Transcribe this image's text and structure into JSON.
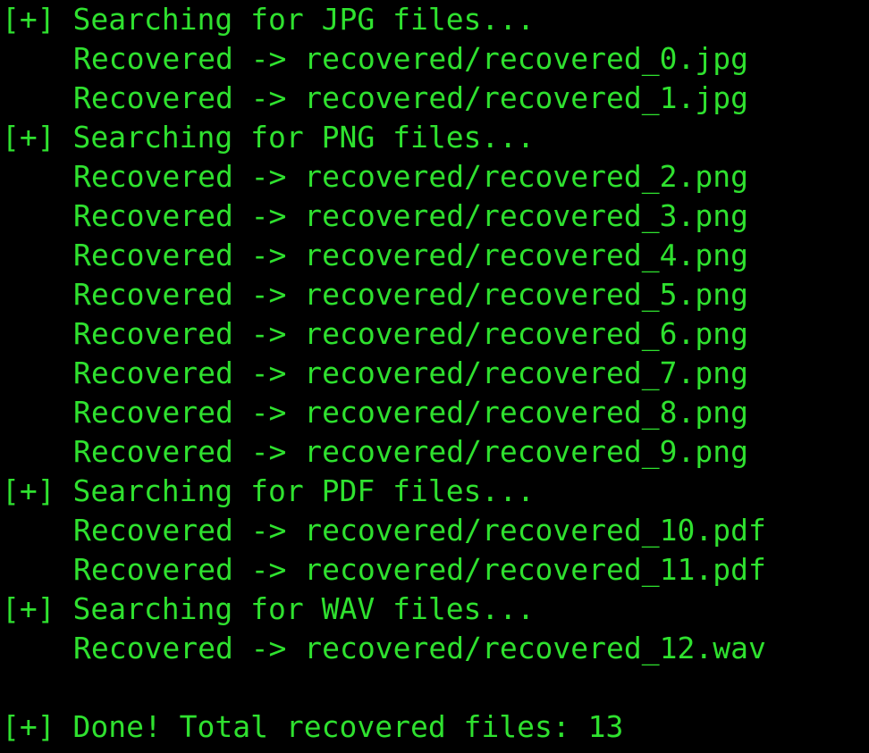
{
  "terminal": {
    "text_color": "#2fe12f",
    "background": "#000000",
    "lines": [
      {
        "text": "[+] Searching for JPG files...",
        "indent": false
      },
      {
        "text": "Recovered -> recovered/recovered_0.jpg",
        "indent": true
      },
      {
        "text": "Recovered -> recovered/recovered_1.jpg",
        "indent": true
      },
      {
        "text": "[+] Searching for PNG files...",
        "indent": false
      },
      {
        "text": "Recovered -> recovered/recovered_2.png",
        "indent": true
      },
      {
        "text": "Recovered -> recovered/recovered_3.png",
        "indent": true
      },
      {
        "text": "Recovered -> recovered/recovered_4.png",
        "indent": true
      },
      {
        "text": "Recovered -> recovered/recovered_5.png",
        "indent": true
      },
      {
        "text": "Recovered -> recovered/recovered_6.png",
        "indent": true
      },
      {
        "text": "Recovered -> recovered/recovered_7.png",
        "indent": true
      },
      {
        "text": "Recovered -> recovered/recovered_8.png",
        "indent": true
      },
      {
        "text": "Recovered -> recovered/recovered_9.png",
        "indent": true
      },
      {
        "text": "[+] Searching for PDF files...",
        "indent": false
      },
      {
        "text": "Recovered -> recovered/recovered_10.pdf",
        "indent": true
      },
      {
        "text": "Recovered -> recovered/recovered_11.pdf",
        "indent": true
      },
      {
        "text": "[+] Searching for WAV files...",
        "indent": false
      },
      {
        "text": "Recovered -> recovered/recovered_12.wav",
        "indent": true
      },
      {
        "text": "",
        "indent": false
      },
      {
        "text": "[+] Done! Total recovered files: 13",
        "indent": false
      }
    ]
  }
}
